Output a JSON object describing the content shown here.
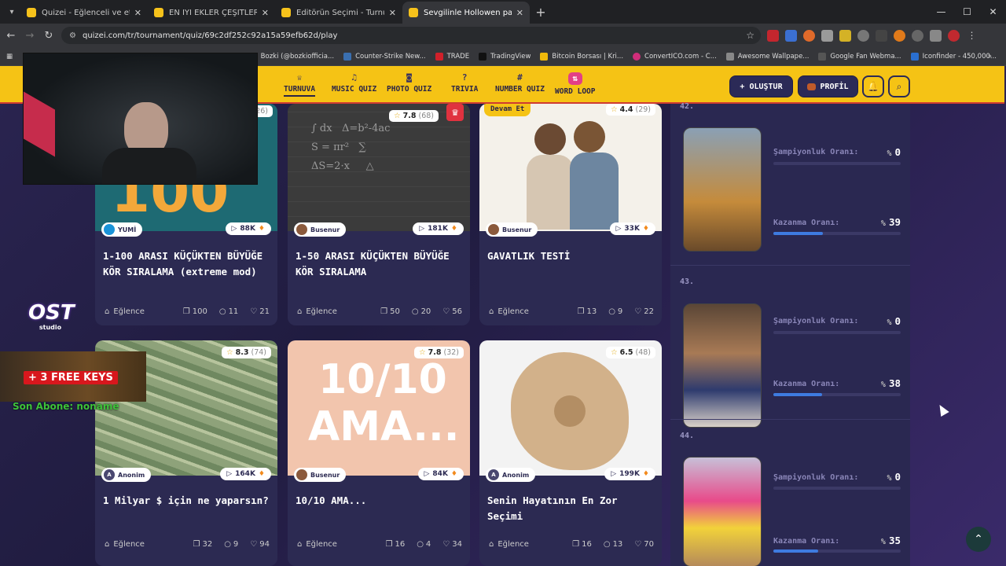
{
  "browser": {
    "tabs": [
      {
        "title": "Quizei - Eğlenceli ve etkileşimli",
        "active": false
      },
      {
        "title": "EN İYİ EKLER ÇEŞİTLERİ - Tier Li",
        "active": false
      },
      {
        "title": "Editörün Seçimi - Turnuva - Qui",
        "active": false
      },
      {
        "title": "Sevgilinle Hollowen partisine ka",
        "active": true
      }
    ],
    "url": "quizei.com/tr/tournament/quiz/69c2df252c92a15a59efb62d/play",
    "bookmarks": [
      "Bozki (@bozkiofficia...",
      "Counter-Strike New...",
      "TRADE",
      "TradingView",
      "Bitcoin Borsası | Kri...",
      "ConvertICO.com - C...",
      "Awesome Wallpape...",
      "Google Fan Webma...",
      "Iconfinder - 450,000..."
    ]
  },
  "site_nav": [
    {
      "label": "TURNUVA",
      "icon": "trophy-icon",
      "active": true
    },
    {
      "label": "MUSIC QUIZ",
      "icon": "music-icon",
      "active": false
    },
    {
      "label": "PHOTO QUIZ",
      "icon": "camera-icon",
      "active": false
    },
    {
      "label": "TRIVIA",
      "icon": "question-icon",
      "active": false
    },
    {
      "label": "NUMBER QUIZ",
      "icon": "hash-icon",
      "active": false
    },
    {
      "label": "WORD LOOP",
      "icon": "loop-icon",
      "active": false
    }
  ],
  "header_buttons": {
    "create": "+ OLUŞTUR",
    "profile": "PROFİL"
  },
  "cards": [
    {
      "rating": "",
      "count": "26)",
      "author": "YUMİ",
      "plays": "88K",
      "title": "1-100 ARASI KÜÇÜKTEN BÜYÜĞE KÖR SIRALAMA (extreme mod)",
      "category": "Eğlence",
      "questions": "100",
      "comments": "11",
      "likes": "21"
    },
    {
      "rating": "7.8",
      "count": "(68)",
      "author": "Busenur",
      "plays": "181K",
      "title": "1-50 ARASI KÜÇÜKTEN BÜYÜĞE KÖR SIRALAMA",
      "category": "Eğlence",
      "questions": "50",
      "comments": "20",
      "likes": "56"
    },
    {
      "rating": "4.4",
      "count": "(29)",
      "author": "Busenur",
      "plays": "33K",
      "title": "GAVATLIK TESTİ",
      "category": "Eğlence",
      "questions": "13",
      "comments": "9",
      "likes": "22",
      "badge": "Devam Et"
    },
    {
      "rating": "8.3",
      "count": "(74)",
      "author": "Anonim",
      "plays": "164K",
      "title": "1 Milyar $ için ne yaparsın?",
      "category": "Eğlence",
      "questions": "32",
      "comments": "9",
      "likes": "94"
    },
    {
      "rating": "7.8",
      "count": "(32)",
      "author": "Busenur",
      "plays": "84K",
      "title": "10/10 AMA...",
      "category": "Eğlence",
      "questions": "16",
      "comments": "4",
      "likes": "34",
      "thumb_text": "10/10 AMA..."
    },
    {
      "rating": "6.5",
      "count": "(48)",
      "author": "Anonim",
      "plays": "199K",
      "title": "Senin Hayatının En Zor Seçimi",
      "category": "Eğlence",
      "questions": "16",
      "comments": "13",
      "likes": "70"
    }
  ],
  "leaderboard": {
    "top_rank": "42.",
    "entries": [
      {
        "rank": "42.",
        "champ_label": "Şampiyonluk Oranı:",
        "champ_value": "0",
        "win_label": "Kazanma Oranı:",
        "win_value": "39",
        "win_fraction": 0.39
      },
      {
        "rank": "43.",
        "champ_label": "Şampiyonluk Oranı:",
        "champ_value": "0",
        "win_label": "Kazanma Oranı:",
        "win_value": "38",
        "win_fraction": 0.38
      },
      {
        "rank": "44.",
        "champ_label": "Şampiyonluk Oranı:",
        "champ_value": "0",
        "win_label": "Kazanma Oranı:",
        "win_value": "35",
        "win_fraction": 0.35
      }
    ],
    "percent_sign": "%"
  },
  "overlay": {
    "logo_text": "OST",
    "logo_sub": "studio",
    "keys_text": "+ 3 FREE KEYS",
    "subscriber": "Son Abone: noname"
  },
  "colors": {
    "brand_yellow": "#f5c315",
    "accent_red": "#cf3b32",
    "panel": "#2a2851",
    "bar_fill": "#3e7be0"
  }
}
